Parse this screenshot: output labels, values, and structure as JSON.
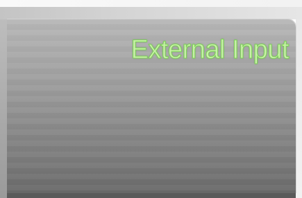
{
  "panel": {
    "title": "External Input",
    "title_color": "#c8f0a8",
    "title_outline_color": "#7fd35a"
  }
}
